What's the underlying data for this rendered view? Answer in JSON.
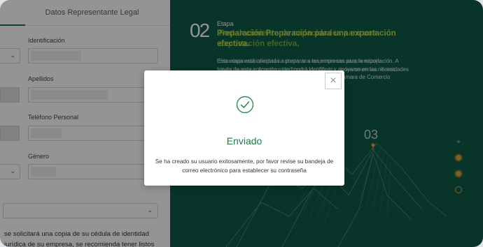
{
  "form": {
    "section_title": "Datos Representante Legal",
    "fields": [
      {
        "label": "Identificación"
      },
      {
        "label": "Apellidos"
      },
      {
        "label": "Teléfono Personal"
      },
      {
        "label": "Género"
      }
    ],
    "info_text": "se solicitará una copia de su cédula de identidad jurídica de su empresa, se recomienda tener listos"
  },
  "stage": {
    "number": "02",
    "label": "Etapa",
    "title_a": "Preparación Preparación para una exportación efectiva.",
    "title_b": "Fortalecimiento de capacidades para una exportación efectiva.",
    "desc_a": "Esta etapa está orientada a preparar a las empresas para la exportación. A través de esta aplicación usted podrá identificar y apoyarse en las necesidades identificadas de la empresa. Esta etapa incluye la Cámara de Comercio",
    "desc_b": "Esta etapa está dirigida a reforzar las empresas con el aprendizaje, capacitaciones, apoyo en las áreas identificadas de las empresas. Estos factores de Comercio",
    "next_number": "03"
  },
  "modal": {
    "title": "Enviado",
    "message": "Se ha creado su usuario exitosamente, por favor revise su bandeja de correo electrónico para establecer su contraseña",
    "close_label": "×"
  },
  "colors": {
    "green_panel": "#0e5a47",
    "accent_lime": "#b5d64a",
    "success_green": "#1f7a4a",
    "orange_dot": "#e3a23a"
  }
}
